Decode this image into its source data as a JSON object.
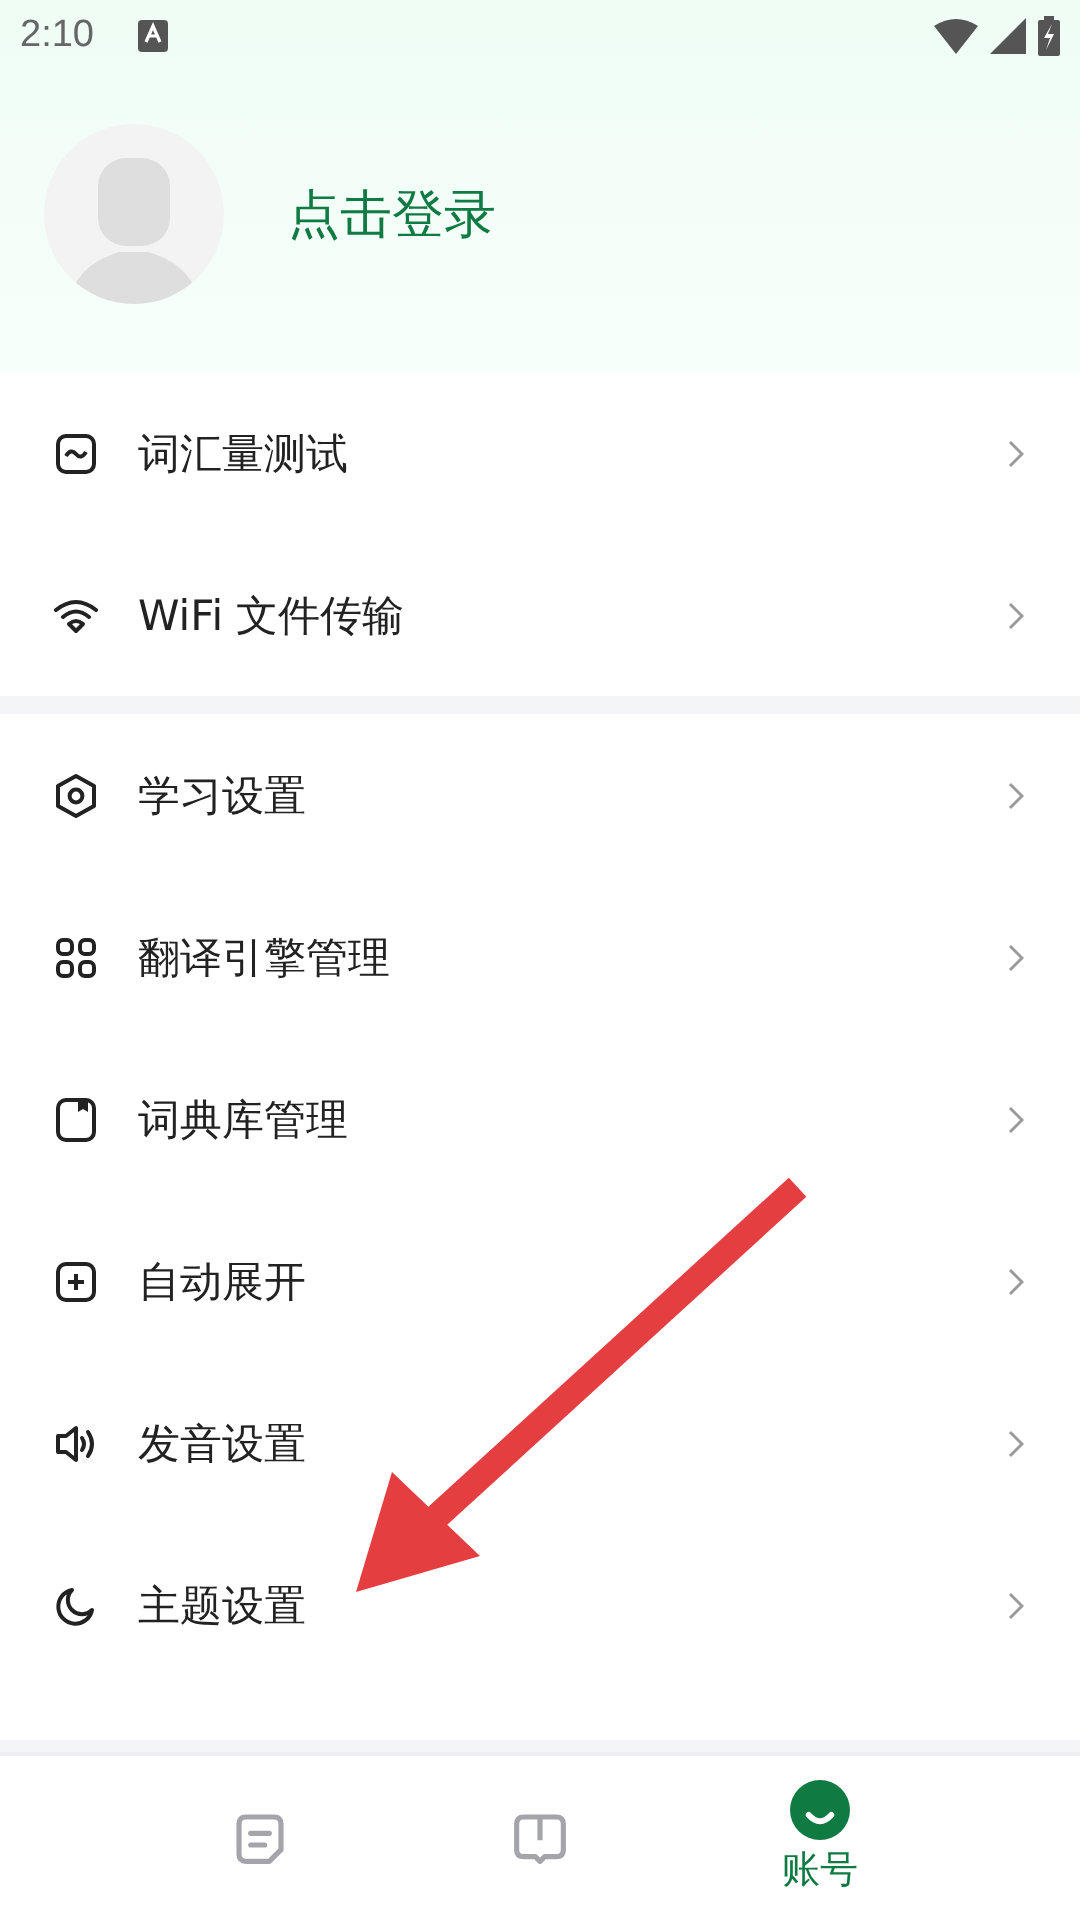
{
  "status_bar": {
    "time": "2:10"
  },
  "profile": {
    "login_label": "点击登录"
  },
  "menu_groups": [
    {
      "items": [
        {
          "kind": "chart",
          "label": "词汇量测试"
        },
        {
          "kind": "wifi",
          "label": "WiFi 文件传输"
        }
      ]
    },
    {
      "items": [
        {
          "kind": "hexagon",
          "label": "学习设置"
        },
        {
          "kind": "grid",
          "label": "翻译引擎管理"
        },
        {
          "kind": "book",
          "label": "词典库管理"
        },
        {
          "kind": "plus",
          "label": "自动展开"
        },
        {
          "kind": "speaker",
          "label": "发音设置"
        },
        {
          "kind": "moon",
          "label": "主题设置"
        }
      ]
    }
  ],
  "annotation": {
    "kind": "arrow"
  },
  "bottom_nav": [
    {
      "kind": "note",
      "selected": false
    },
    {
      "kind": "book",
      "selected": false
    },
    {
      "kind": "face",
      "selected": true,
      "label": "账号"
    }
  ]
}
